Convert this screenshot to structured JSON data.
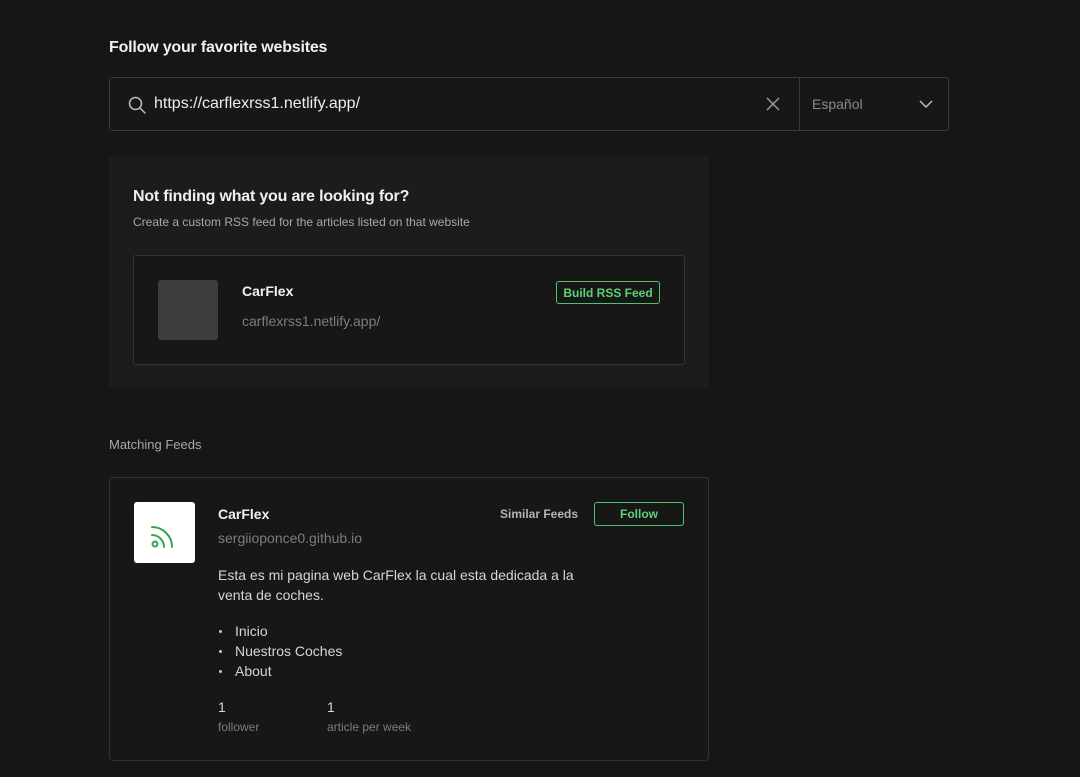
{
  "header": {
    "title": "Follow your favorite websites"
  },
  "search": {
    "value": "https://carflexrss1.netlify.app/",
    "language": "Español"
  },
  "custom_feed": {
    "title": "Not finding what you are looking for?",
    "subtitle": "Create a custom RSS feed for the articles listed on that website",
    "site_name": "CarFlex",
    "site_url": "carflexrss1.netlify.app/",
    "build_label": "Build RSS Feed"
  },
  "matching": {
    "section_label": "Matching Feeds",
    "feeds": [
      {
        "name": "CarFlex",
        "domain": "sergiioponce0.github.io",
        "similar_label": "Similar Feeds",
        "follow_label": "Follow",
        "description": "Esta es mi pagina web CarFlex la cual esta dedicada a la venta de coches.",
        "links": [
          "Inicio",
          "Nuestros Coches",
          "About"
        ],
        "followers_value": "1",
        "followers_label": "follower",
        "articles_value": "1",
        "articles_label": "article per week"
      }
    ]
  },
  "colors": {
    "background": "#161616",
    "accent": "#4ec26c",
    "rss_icon": "#35a64f"
  },
  "icons": {
    "search": "search-icon",
    "clear": "close-icon",
    "dropdown": "chevron-down-icon",
    "feed": "rss-icon"
  }
}
